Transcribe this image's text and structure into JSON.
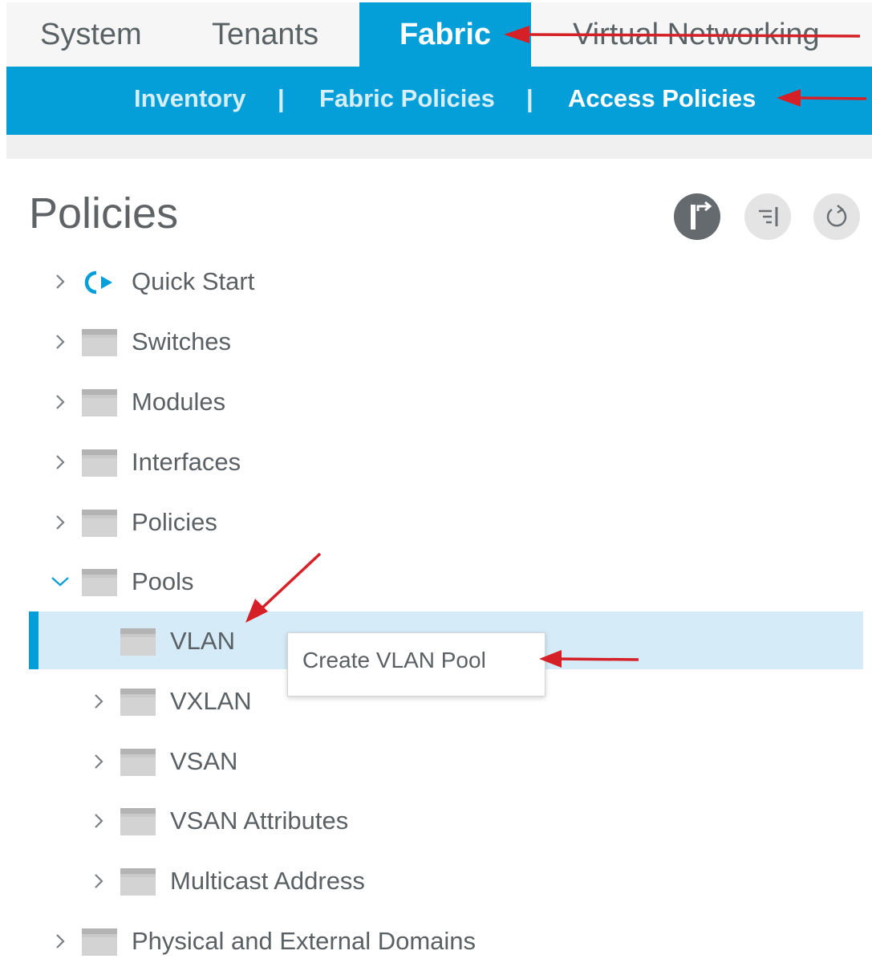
{
  "top_tabs": [
    "System",
    "Tenants",
    "Fabric",
    "Virtual Networking"
  ],
  "sub_nav": {
    "items": [
      "Inventory",
      "Fabric Policies",
      "Access Policies"
    ],
    "separator": "|"
  },
  "panel": {
    "title": "Policies",
    "header_icons": [
      "enter-icon",
      "collapse-icon",
      "refresh-icon"
    ]
  },
  "tree": {
    "quick_start": "Quick Start",
    "switches": "Switches",
    "modules": "Modules",
    "interfaces": "Interfaces",
    "policies": "Policies",
    "pools": "Pools",
    "vlan": "VLAN",
    "vxlan": "VXLAN",
    "vsan": "VSAN",
    "vsan_attributes": "VSAN Attributes",
    "multicast_address": "Multicast Address",
    "physical_external_domains": "Physical and External Domains"
  },
  "context_menu": {
    "create_vlan_pool": "Create VLAN Pool"
  },
  "colors": {
    "accent": "#049fd9",
    "selection": "#d5ebf7",
    "annotation_arrow": "#d62027"
  }
}
